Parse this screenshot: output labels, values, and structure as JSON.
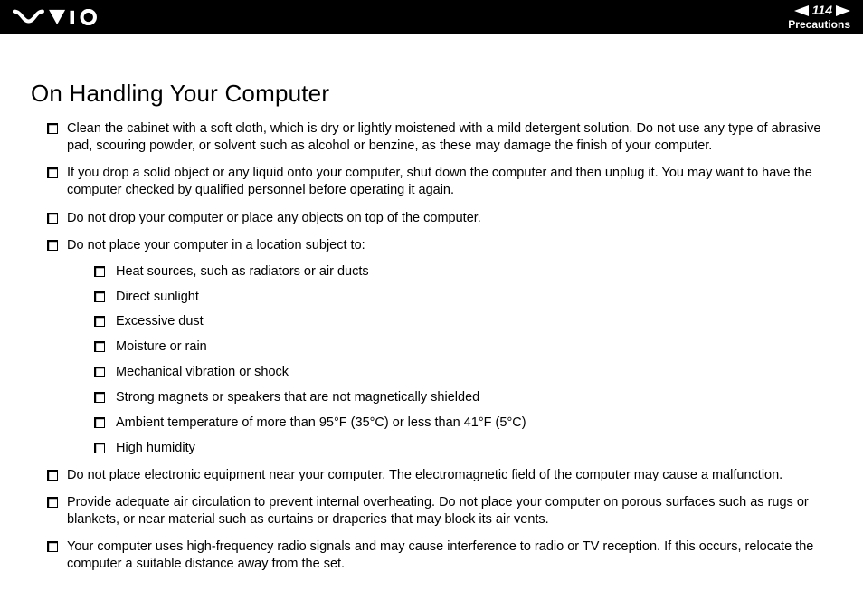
{
  "header": {
    "page_number": "114",
    "section": "Precautions"
  },
  "title": "On Handling Your Computer",
  "bullets": {
    "b1": "Clean the cabinet with a soft cloth, which is dry or lightly moistened with a mild detergent solution. Do not use any type of abrasive pad, scouring powder, or solvent such as alcohol or benzine, as these may damage the finish of your computer.",
    "b2": "If you drop a solid object or any liquid onto your computer, shut down the computer and then unplug it. You may want to have the computer checked by qualified personnel before operating it again.",
    "b3": "Do not drop your computer or place any objects on top of the computer.",
    "b4": "Do not place your computer in a location subject to:",
    "b4_sub": {
      "s1": "Heat sources, such as radiators or air ducts",
      "s2": "Direct sunlight",
      "s3": "Excessive dust",
      "s4": "Moisture or rain",
      "s5": "Mechanical vibration or shock",
      "s6": "Strong magnets or speakers that are not magnetically shielded",
      "s7": "Ambient temperature of more than 95°F (35°C) or less than 41°F (5°C)",
      "s8": "High humidity"
    },
    "b5": "Do not place electronic equipment near your computer. The electromagnetic field of the computer may cause a malfunction.",
    "b6": "Provide adequate air circulation to prevent internal overheating. Do not place your computer on porous surfaces such as rugs or blankets, or near material such as curtains or draperies that may block its air vents.",
    "b7": "Your computer uses high-frequency radio signals and may cause interference to radio or TV reception. If this occurs, relocate the computer a suitable distance away from the set."
  }
}
